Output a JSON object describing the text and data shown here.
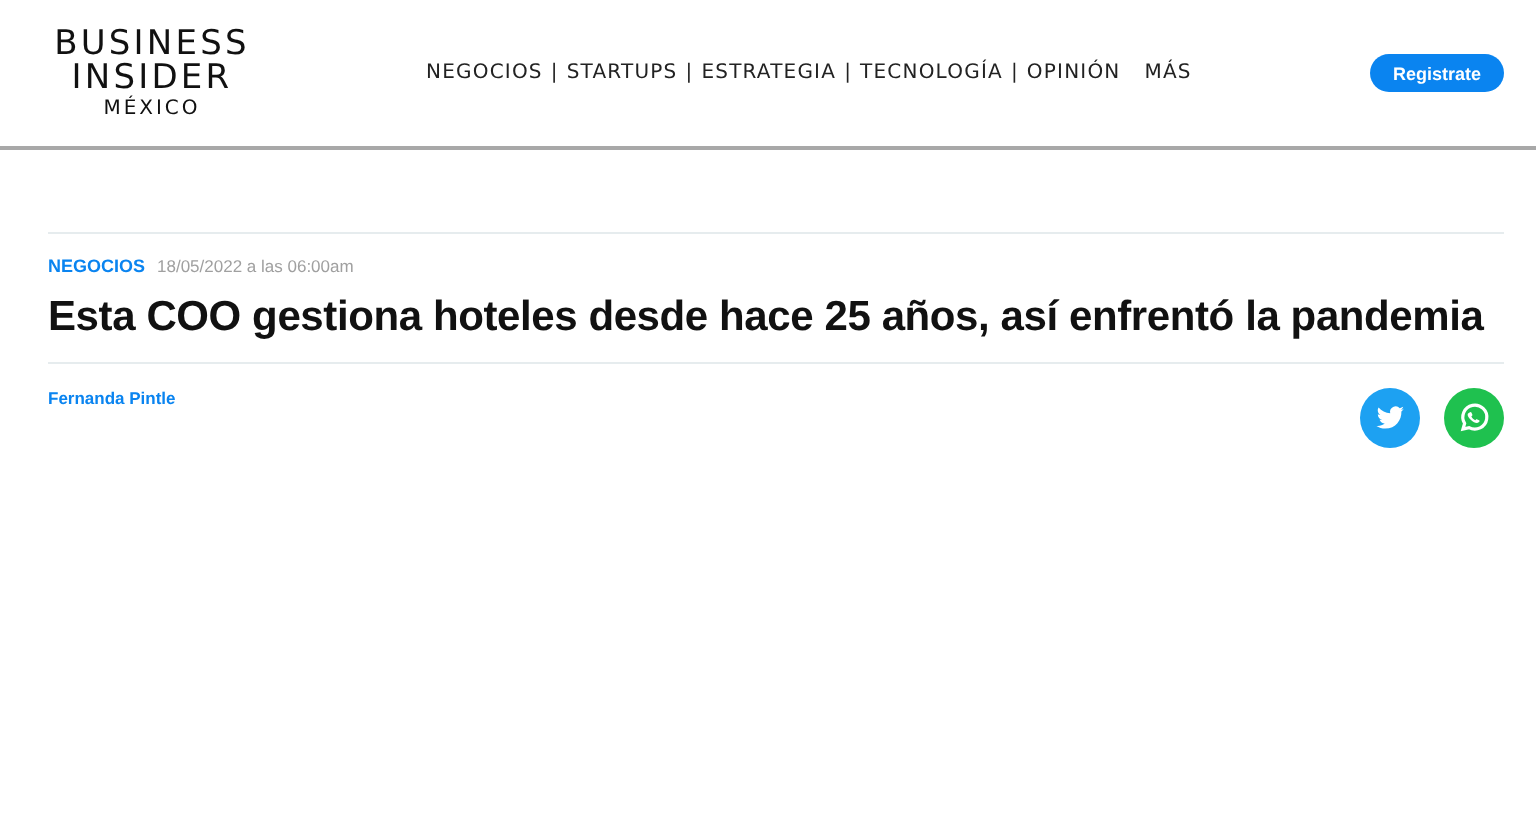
{
  "logo": {
    "line_1": "BUSINESS",
    "line_2": "INSIDER",
    "line_3": "MÉXICO"
  },
  "nav": {
    "items": [
      {
        "label": "NEGOCIOS",
        "separator": "|"
      },
      {
        "label": "STARTUPS",
        "separator": "|"
      },
      {
        "label": "ESTRATEGIA",
        "separator": "|"
      },
      {
        "label": "TECNOLOGÍA",
        "separator": "|"
      },
      {
        "label": "OPINIÓN"
      },
      {
        "label": "MÁS"
      }
    ]
  },
  "register_button": "Registrate",
  "article": {
    "category": "NEGOCIOS",
    "date": "18/05/2022 a las 06:00am",
    "title": "Esta COO gestiona hoteles desde hace 25 años, así enfrentó la pandemia",
    "author": "Fernanda Pintle",
    "share": [
      {
        "kind": "twitter"
      },
      {
        "kind": "whatsapp"
      }
    ]
  }
}
